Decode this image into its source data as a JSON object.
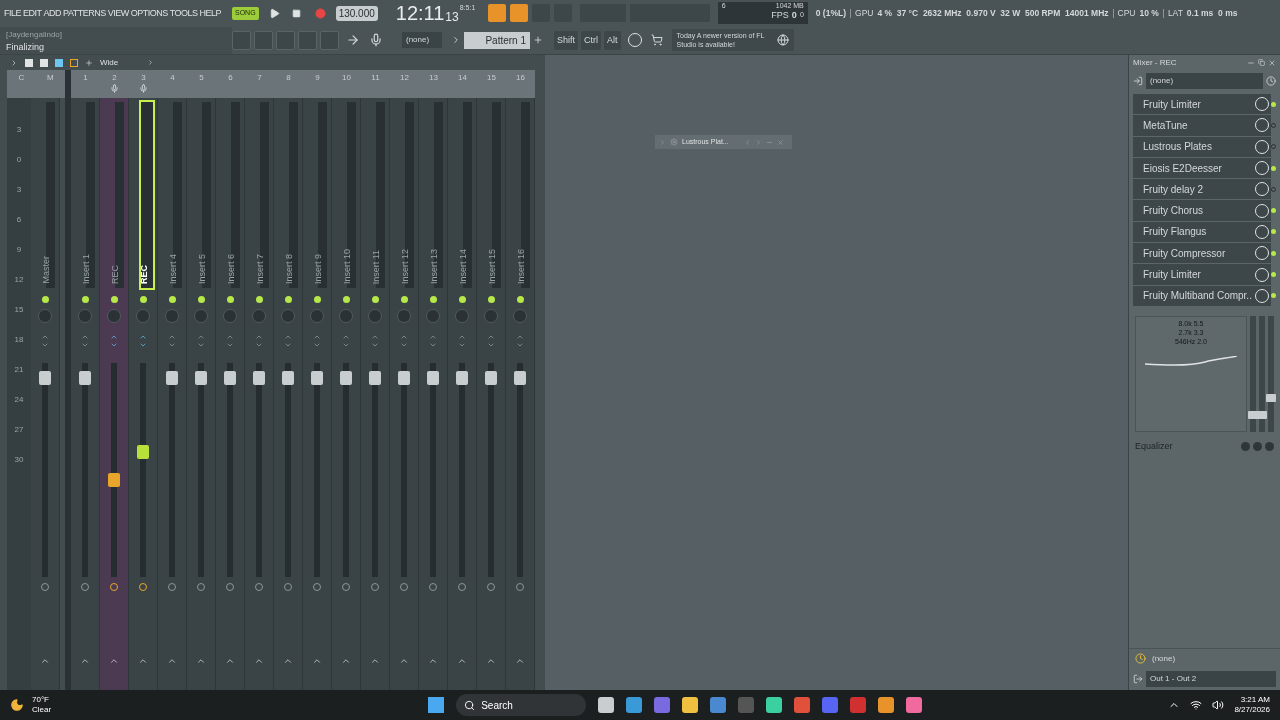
{
  "menu": [
    "FILE",
    "EDIT",
    "ADD",
    "PATTERNS",
    "VIEW",
    "OPTIONS",
    "TOOLS",
    "HELP"
  ],
  "transport": {
    "song_label": "SONG",
    "song_mode": true,
    "tempo": "130.000",
    "time_main": "12:11",
    "time_small": "13",
    "time_bars": "8:5:1"
  },
  "hint": {
    "user": "[Jaydengalindo]",
    "status": "Finalizing"
  },
  "toolbar": {
    "channel": "(none)",
    "pattern": "Pattern 1",
    "keys": [
      "Shift",
      "Ctrl",
      "Alt"
    ]
  },
  "news": {
    "message": "Today A newer version of FL Studio is available!"
  },
  "performance": {
    "cpu_value": "6",
    "memory": "1042 MB",
    "fps_label": "FPS",
    "fps_value": "0",
    "fps_sub": "0",
    "stats": [
      {
        "value": "0 (1%L)"
      },
      {
        "label": "GPU",
        "value": "4 %  37 °C  2632 MHz  0.970 V  32 W  500 RPM  14001 MHz"
      },
      {
        "label": "CPU",
        "value": "10 %"
      },
      {
        "label": "LAT",
        "value": "0.1 ms  0 ms"
      }
    ]
  },
  "mixer": {
    "view": "Wide",
    "scale": [
      "3",
      "0",
      "3",
      "6",
      "9",
      "12",
      "15",
      "18",
      "21",
      "24",
      "27",
      "30"
    ],
    "master": {
      "header_c": "C",
      "header_m": "M",
      "name": "Master",
      "level": 0.96
    },
    "tracks": [
      {
        "number": "1",
        "name": "Insert 1",
        "selected": false,
        "highlighted": false,
        "input": false,
        "level": 0.96
      },
      {
        "number": "2",
        "name": "REC",
        "selected": false,
        "highlighted": true,
        "input": true,
        "level": 0.45
      },
      {
        "number": "3",
        "name": "REC",
        "selected": true,
        "highlighted": false,
        "input": true,
        "level": 0.59
      },
      {
        "number": "4",
        "name": "Insert 4",
        "selected": false,
        "highlighted": false,
        "input": false,
        "level": 0.96
      },
      {
        "number": "5",
        "name": "Insert 5",
        "selected": false,
        "highlighted": false,
        "input": false,
        "level": 0.96
      },
      {
        "number": "6",
        "name": "Insert 6",
        "selected": false,
        "highlighted": false,
        "input": false,
        "level": 0.96
      },
      {
        "number": "7",
        "name": "Insert 7",
        "selected": false,
        "highlighted": false,
        "input": false,
        "level": 0.96
      },
      {
        "number": "8",
        "name": "Insert 8",
        "selected": false,
        "highlighted": false,
        "input": false,
        "level": 0.96
      },
      {
        "number": "9",
        "name": "Insert 9",
        "selected": false,
        "highlighted": false,
        "input": false,
        "level": 0.96
      },
      {
        "number": "10",
        "name": "Insert 10",
        "selected": false,
        "highlighted": false,
        "input": false,
        "level": 0.96
      },
      {
        "number": "11",
        "name": "Insert 11",
        "selected": false,
        "highlighted": false,
        "input": false,
        "level": 0.96
      },
      {
        "number": "12",
        "name": "Insert 12",
        "selected": false,
        "highlighted": false,
        "input": false,
        "level": 0.96
      },
      {
        "number": "13",
        "name": "Insert 13",
        "selected": false,
        "highlighted": false,
        "input": false,
        "level": 0.96
      },
      {
        "number": "14",
        "name": "Insert 14",
        "selected": false,
        "highlighted": false,
        "input": false,
        "level": 0.96
      },
      {
        "number": "15",
        "name": "Insert 15",
        "selected": false,
        "highlighted": false,
        "input": false,
        "level": 0.96
      },
      {
        "number": "16",
        "name": "Insert 16",
        "selected": false,
        "highlighted": false,
        "input": false,
        "level": 0.96
      }
    ]
  },
  "plugin_window": {
    "title": "Lustrous Plat..."
  },
  "insert_panel": {
    "title": "Mixer - REC",
    "input": "(none)",
    "slots": [
      {
        "name": "Fruity Limiter",
        "on": true
      },
      {
        "name": "MetaTune",
        "on": false
      },
      {
        "name": "Lustrous Plates",
        "on": false
      },
      {
        "name": "Eiosis E2Deesser",
        "on": true
      },
      {
        "name": "Fruity delay 2",
        "on": false
      },
      {
        "name": "Fruity Chorus",
        "on": true
      },
      {
        "name": "Fruity Flangus",
        "on": true
      },
      {
        "name": "Fruity Compressor",
        "on": true
      },
      {
        "name": "Fruity Limiter",
        "on": true
      },
      {
        "name": "Fruity Multiband Compr..",
        "on": true
      }
    ],
    "eq_labels": [
      "8.0k 5.5",
      "2.7k 3.3",
      "546Hz 2.0"
    ],
    "eq_title": "Equalizer",
    "eq_sliders": [
      {
        "level": 0.12
      },
      {
        "level": 0.12
      },
      {
        "level": 0.28
      }
    ],
    "send": "(none)",
    "output": "Out 1 - Out 2"
  },
  "taskbar": {
    "temperature": "70°F",
    "weather": "Clear",
    "search": "Search",
    "time": "3:21 AM",
    "date": "8/27/2026"
  }
}
